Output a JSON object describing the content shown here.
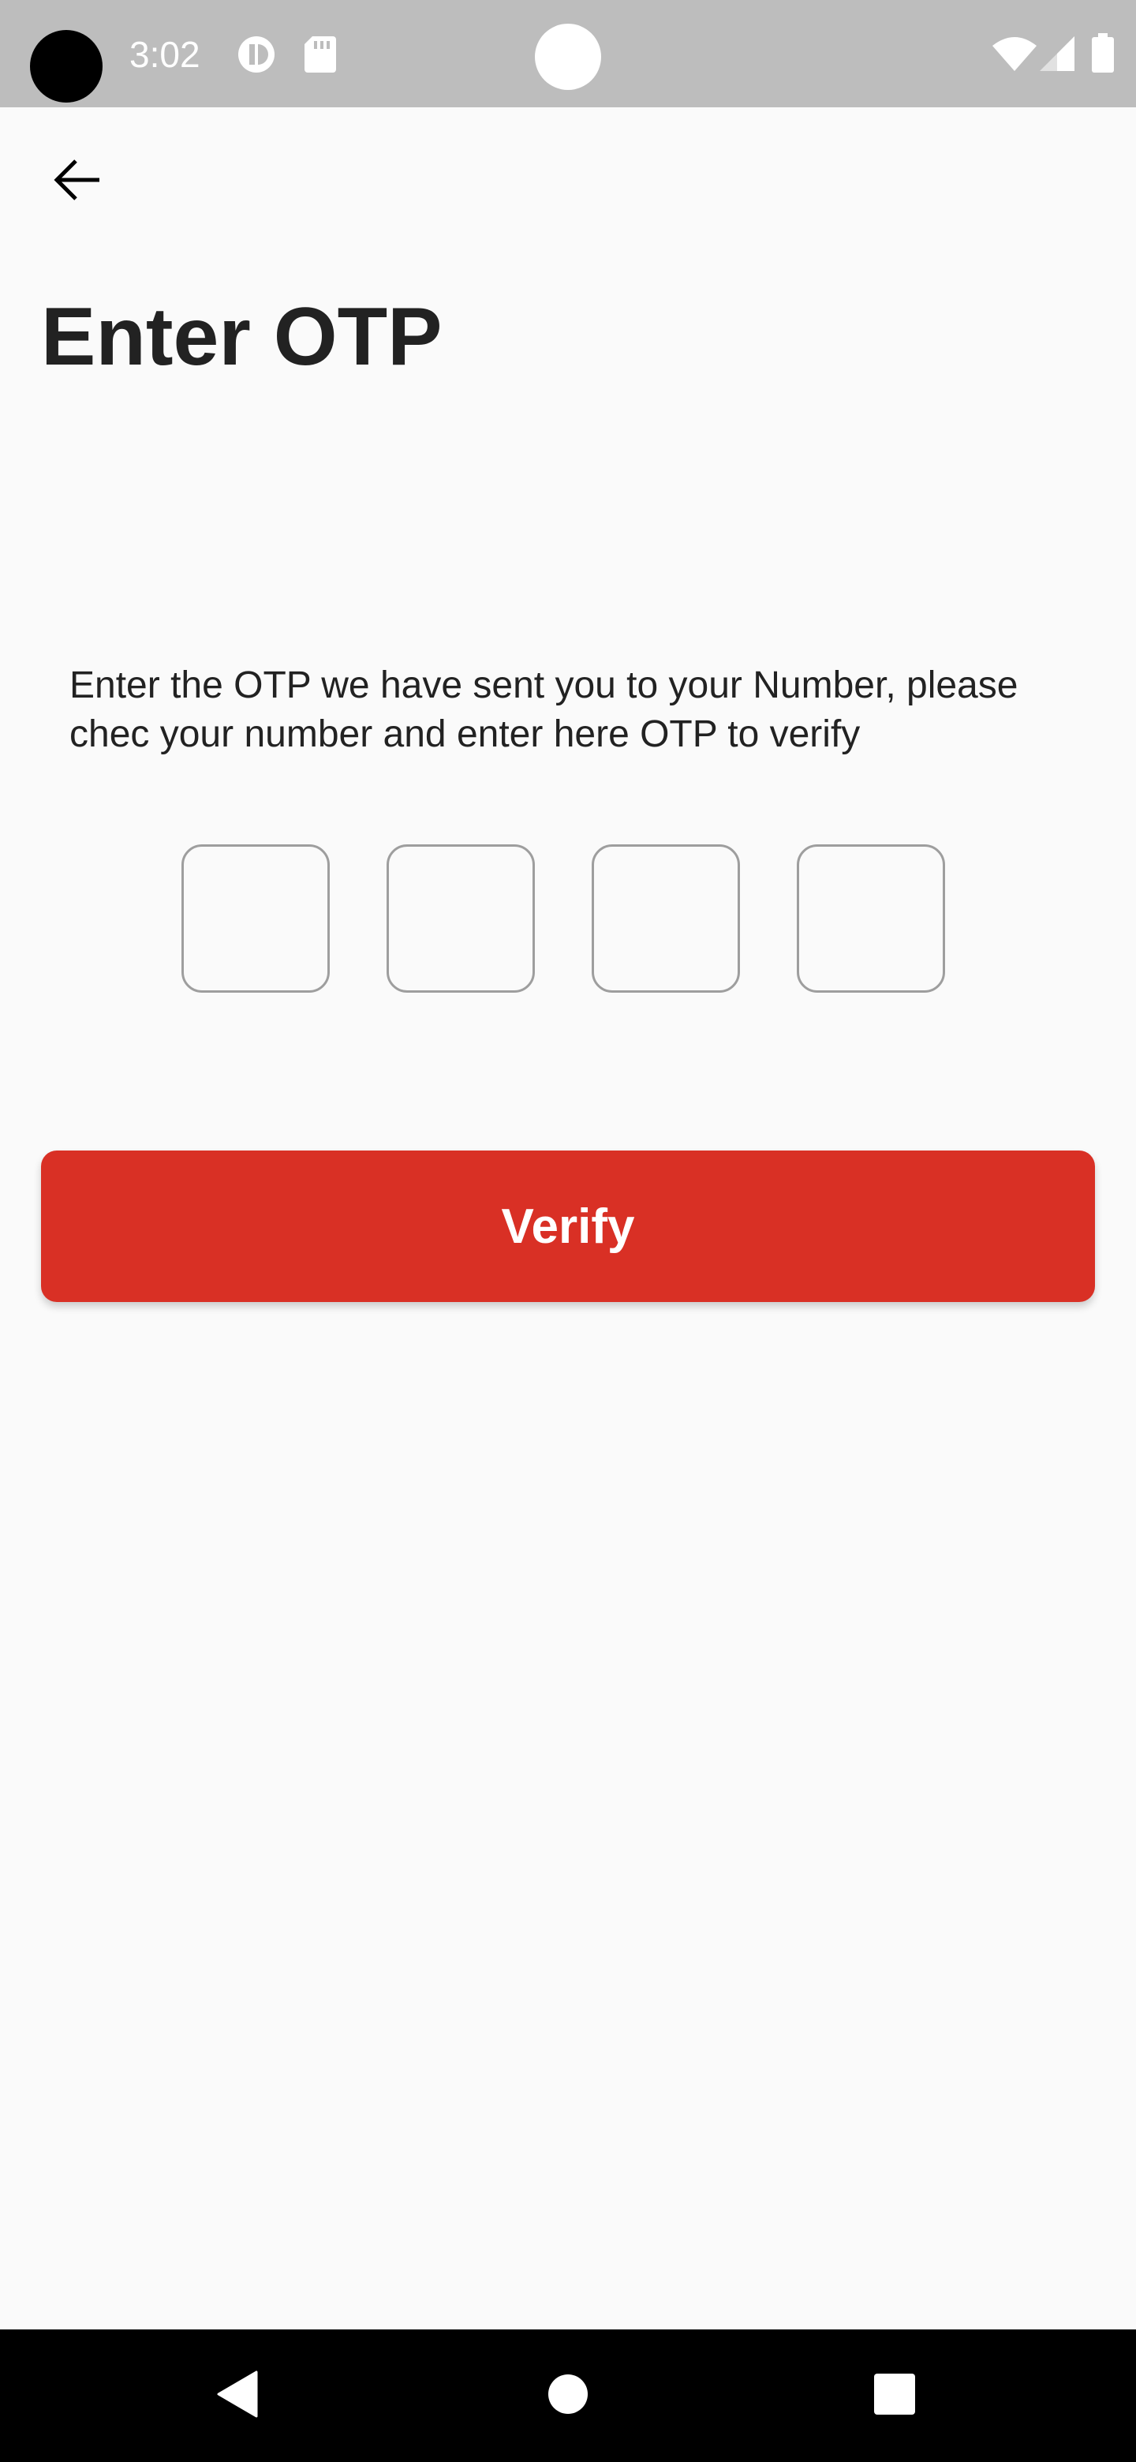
{
  "status_bar": {
    "time": "3:02",
    "icons": [
      "data-saver-icon",
      "sd-card-icon",
      "wifi-icon",
      "signal-icon",
      "battery-icon"
    ]
  },
  "header": {
    "back_icon": "arrow-left-icon",
    "title": "Enter OTP"
  },
  "main": {
    "instructions": "Enter the OTP we have sent you to your Number, please chec your number and enter here OTP to verify",
    "otp": {
      "digits": [
        "",
        "",
        "",
        ""
      ]
    },
    "verify_label": "Verify"
  },
  "nav_bar": {
    "icons": [
      "back-triangle-icon",
      "home-circle-icon",
      "recents-square-icon"
    ]
  },
  "colors": {
    "accent": "#d93025",
    "background": "#fafafa",
    "status_bar": "#bdbdbd"
  }
}
